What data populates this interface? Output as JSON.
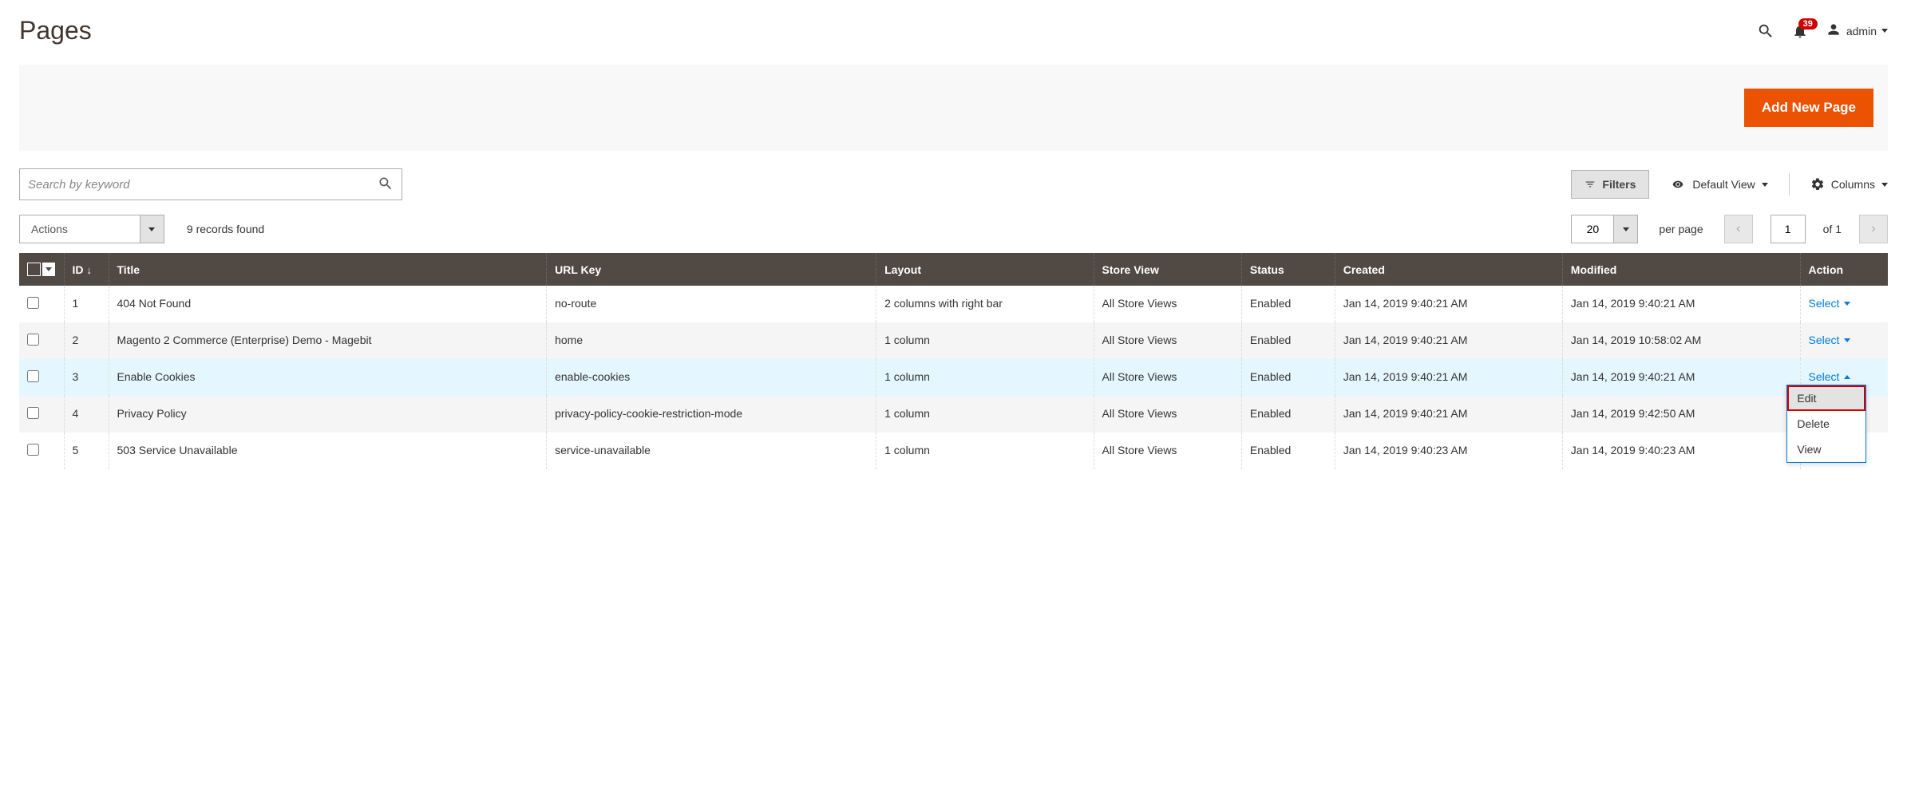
{
  "header": {
    "title": "Pages",
    "notification_count": "39",
    "user": "admin"
  },
  "primary_button": "Add New Page",
  "search": {
    "placeholder": "Search by keyword"
  },
  "toolbar": {
    "filters": "Filters",
    "default_view": "Default View",
    "columns": "Columns"
  },
  "actions": {
    "label": "Actions"
  },
  "records_found": "9 records found",
  "pagination": {
    "page_size": "20",
    "per_page": "per page",
    "current": "1",
    "of_label": "of 1"
  },
  "columns": {
    "id": "ID",
    "title": "Title",
    "url_key": "URL Key",
    "layout": "Layout",
    "store_view": "Store View",
    "status": "Status",
    "created": "Created",
    "modified": "Modified",
    "action": "Action"
  },
  "select_label": "Select",
  "dropdown": {
    "edit": "Edit",
    "delete": "Delete",
    "view": "View"
  },
  "rows": [
    {
      "id": "1",
      "title": "404 Not Found",
      "url_key": "no-route",
      "layout": "2 columns with right bar",
      "store_view": "All Store Views",
      "status": "Enabled",
      "created": "Jan 14, 2019 9:40:21 AM",
      "modified": "Jan 14, 2019 9:40:21 AM"
    },
    {
      "id": "2",
      "title": "Magento 2 Commerce (Enterprise) Demo - Magebit",
      "url_key": "home",
      "layout": "1 column",
      "store_view": "All Store Views",
      "status": "Enabled",
      "created": "Jan 14, 2019 9:40:21 AM",
      "modified": "Jan 14, 2019 10:58:02 AM"
    },
    {
      "id": "3",
      "title": "Enable Cookies",
      "url_key": "enable-cookies",
      "layout": "1 column",
      "store_view": "All Store Views",
      "status": "Enabled",
      "created": "Jan 14, 2019 9:40:21 AM",
      "modified": "Jan 14, 2019 9:40:21 AM"
    },
    {
      "id": "4",
      "title": "Privacy Policy",
      "url_key": "privacy-policy-cookie-restriction-mode",
      "layout": "1 column",
      "store_view": "All Store Views",
      "status": "Enabled",
      "created": "Jan 14, 2019 9:40:21 AM",
      "modified": "Jan 14, 2019 9:42:50 AM"
    },
    {
      "id": "5",
      "title": "503 Service Unavailable",
      "url_key": "service-unavailable",
      "layout": "1 column",
      "store_view": "All Store Views",
      "status": "Enabled",
      "created": "Jan 14, 2019 9:40:23 AM",
      "modified": "Jan 14, 2019 9:40:23 AM"
    }
  ]
}
